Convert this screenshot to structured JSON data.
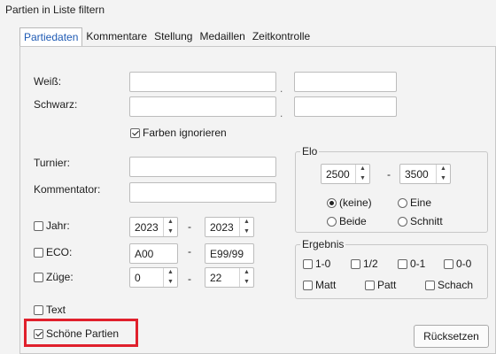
{
  "window": {
    "title": "Partien in Liste filtern"
  },
  "tabs": [
    {
      "label": "Partiedaten"
    },
    {
      "label": "Kommentare"
    },
    {
      "label": "Stellung"
    },
    {
      "label": "Medaillen"
    },
    {
      "label": "Zeitkontrolle"
    }
  ],
  "players": {
    "white_label": "Weiß:",
    "black_label": "Schwarz:",
    "separator": ".",
    "ignore_colors_label": "Farben ignorieren"
  },
  "event": {
    "tournament_label": "Turnier:",
    "commentator_label": "Kommentator:"
  },
  "ranges": {
    "dash": "-",
    "year": {
      "label": "Jahr:",
      "from": "2023",
      "to": "2023"
    },
    "eco": {
      "label": "ECO:",
      "from": "A00",
      "to": "E99/99"
    },
    "moves": {
      "label": "Züge:",
      "from": "0",
      "to": "22"
    }
  },
  "text_label": "Text",
  "nice_games_label": "Schöne Partien",
  "elo": {
    "title": "Elo",
    "min": "2500",
    "max": "3500",
    "dash": "-",
    "options": [
      "(keine)",
      "Eine",
      "Beide",
      "Schnitt"
    ]
  },
  "result": {
    "title": "Ergebnis",
    "options": [
      "1-0",
      "1/2",
      "0-1",
      "0-0",
      "Matt",
      "Patt",
      "Schach"
    ]
  },
  "reset_label": "Rücksetzen",
  "colors": {
    "accent": "#1e5ab4",
    "highlight": "#e0202c"
  }
}
